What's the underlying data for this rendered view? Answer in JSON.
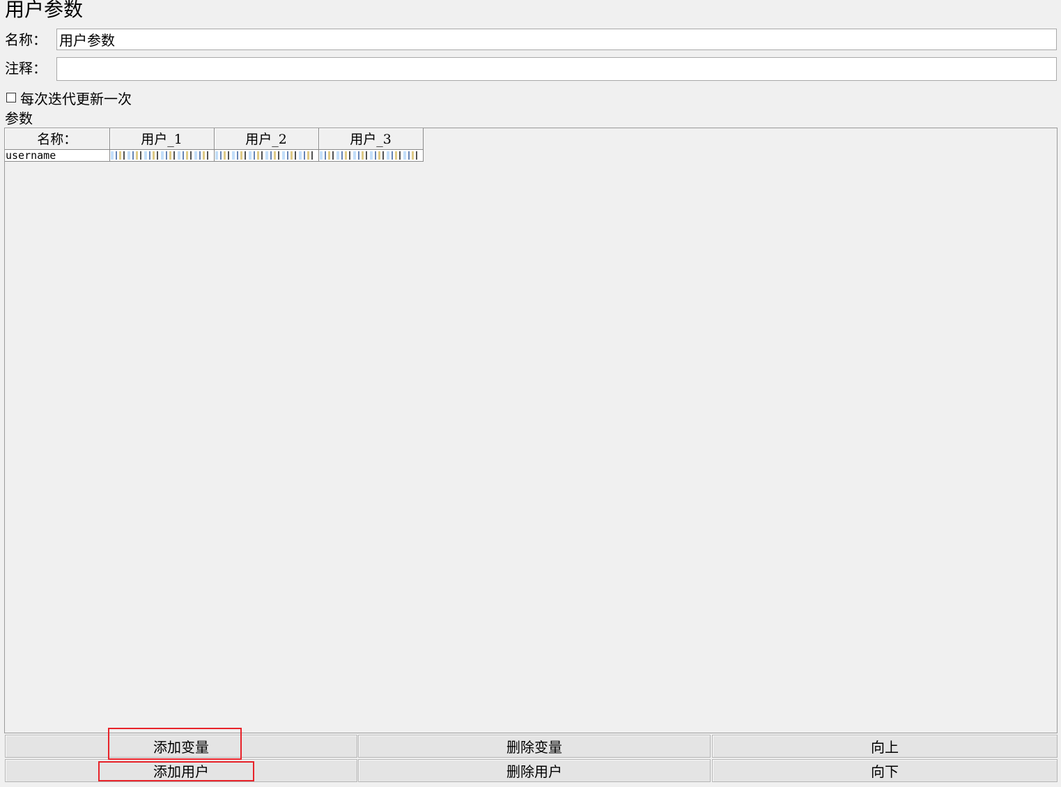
{
  "panel": {
    "title": "用户参数"
  },
  "form": {
    "name_label": "名称：",
    "name_value": "用户参数",
    "comment_label": "注释：",
    "comment_value": "",
    "update_each_iteration_label": "每次迭代更新一次",
    "update_each_iteration_checked": false
  },
  "parameters": {
    "section_label": "参数",
    "columns": [
      "名称：",
      "用户_1",
      "用户_2",
      "用户_3"
    ],
    "rows": [
      {
        "name": "username",
        "values": [
          "[redacted]",
          "[redacted]",
          "[redacted]"
        ]
      }
    ]
  },
  "buttons": {
    "add_variable": "添加变量",
    "delete_variable": "删除变量",
    "move_up": "向上",
    "add_user": "添加用户",
    "delete_user": "删除用户",
    "move_down": "向下"
  },
  "colors": {
    "background": "#f0f0f0",
    "highlight": "#e8232a"
  }
}
